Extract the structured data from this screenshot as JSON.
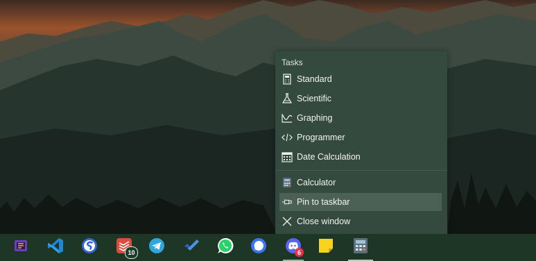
{
  "jumplist": {
    "header": "Tasks",
    "items": [
      {
        "label": "Standard",
        "icon": "standard-calculator-icon"
      },
      {
        "label": "Scientific",
        "icon": "flask-icon"
      },
      {
        "label": "Graphing",
        "icon": "graph-icon"
      },
      {
        "label": "Programmer",
        "icon": "code-icon"
      },
      {
        "label": "Date Calculation",
        "icon": "calendar-icon"
      }
    ],
    "actions": [
      {
        "label": "Calculator",
        "icon": "calculator-app-icon"
      },
      {
        "label": "Pin to taskbar",
        "icon": "pin-icon"
      },
      {
        "label": "Close window",
        "icon": "close-icon"
      }
    ]
  },
  "taskbar": {
    "apps": [
      {
        "name": "app-purple-icon"
      },
      {
        "name": "vscode-icon"
      },
      {
        "name": "simplenote-icon"
      },
      {
        "name": "todoist-icon",
        "badge": "10"
      },
      {
        "name": "telegram-icon"
      },
      {
        "name": "microsoft-todo-icon"
      },
      {
        "name": "whatsapp-icon"
      },
      {
        "name": "signal-icon"
      },
      {
        "name": "discord-icon",
        "badge": "6"
      },
      {
        "name": "sticky-notes-icon"
      },
      {
        "name": "calculator-taskbar-icon"
      }
    ]
  },
  "colors": {
    "jumplist_bg": "#344a3e",
    "taskbar_bg": "#1e3626",
    "hover": "#4c6155"
  }
}
